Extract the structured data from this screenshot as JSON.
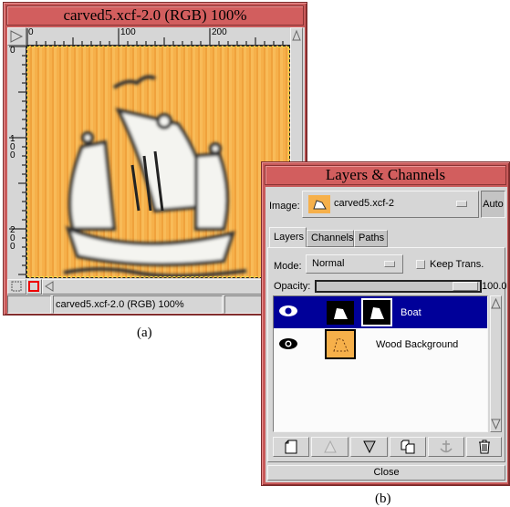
{
  "image_window": {
    "title": "carved5.xcf-2.0 (RGB) 100%",
    "ruler_h_ticks": [
      "0",
      "100",
      "200"
    ],
    "ruler_v_ticks": [
      "0",
      "100",
      "200"
    ],
    "status_text": "carved5.xcf-2.0 (RGB) 100%",
    "caption": "(a)"
  },
  "layers_dialog": {
    "title": "Layers & Channels",
    "image_label": "Image:",
    "image_value": "carved5.xcf-2",
    "auto_label": "Auto",
    "tabs": [
      {
        "label": "Layers",
        "active": true
      },
      {
        "label": "Channels",
        "active": false
      },
      {
        "label": "Paths",
        "active": false
      }
    ],
    "mode_label": "Mode:",
    "mode_value": "Normal",
    "keep_trans_label": "Keep Trans.",
    "keep_trans_checked": false,
    "opacity_label": "Opacity:",
    "opacity_value": "100.0",
    "layers": [
      {
        "name": "Boat",
        "visible": true,
        "selected": true,
        "has_mask": true
      },
      {
        "name": "Wood Background",
        "visible": true,
        "selected": false,
        "has_mask": false
      }
    ],
    "buttons": [
      {
        "name": "new-layer",
        "glyph": "🗋"
      },
      {
        "name": "raise-layer",
        "glyph": "△"
      },
      {
        "name": "lower-layer",
        "glyph": "▽"
      },
      {
        "name": "duplicate-layer",
        "glyph": "⧉"
      },
      {
        "name": "anchor-layer",
        "glyph": "⚓"
      },
      {
        "name": "delete-layer",
        "glyph": "🗑"
      }
    ],
    "close_label": "Close",
    "caption": "(b)"
  },
  "colors": {
    "title_bar": "#d25e5e",
    "selected_row": "#000099",
    "panel": "#d6d6d6",
    "wood": "#f6b04a"
  }
}
